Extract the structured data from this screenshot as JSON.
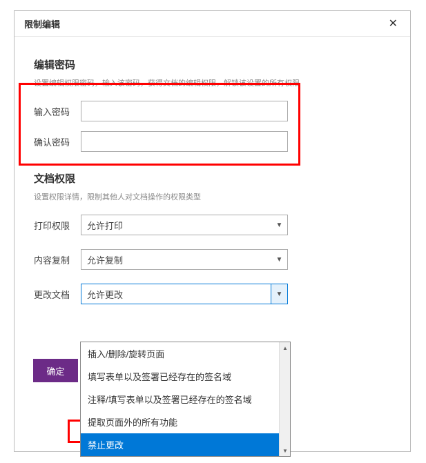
{
  "dialog": {
    "title": "限制编辑"
  },
  "password_section": {
    "title": "编辑密码",
    "desc": "设置编辑权限密码，输入该密码，获得文档的编辑权限，解锁该设置的所有权限",
    "input_label": "输入密码",
    "input_value": "",
    "confirm_label": "确认密码",
    "confirm_value": ""
  },
  "perm_section": {
    "title": "文档权限",
    "desc": "设置权限详情，限制其他人对文档操作的权限类型",
    "print": {
      "label": "打印权限",
      "value": "允许打印"
    },
    "copy": {
      "label": "内容复制",
      "value": "允许复制"
    },
    "change": {
      "label": "更改文档",
      "value": "允许更改"
    }
  },
  "dropdown": {
    "options": [
      "插入/删除/旋转页面",
      "填写表单以及签署已经存在的签名域",
      "注释/填写表单以及签署已经存在的签名域",
      "提取页面外的所有功能",
      "禁止更改"
    ],
    "selected_index": 4
  },
  "confirm_btn": "确定"
}
